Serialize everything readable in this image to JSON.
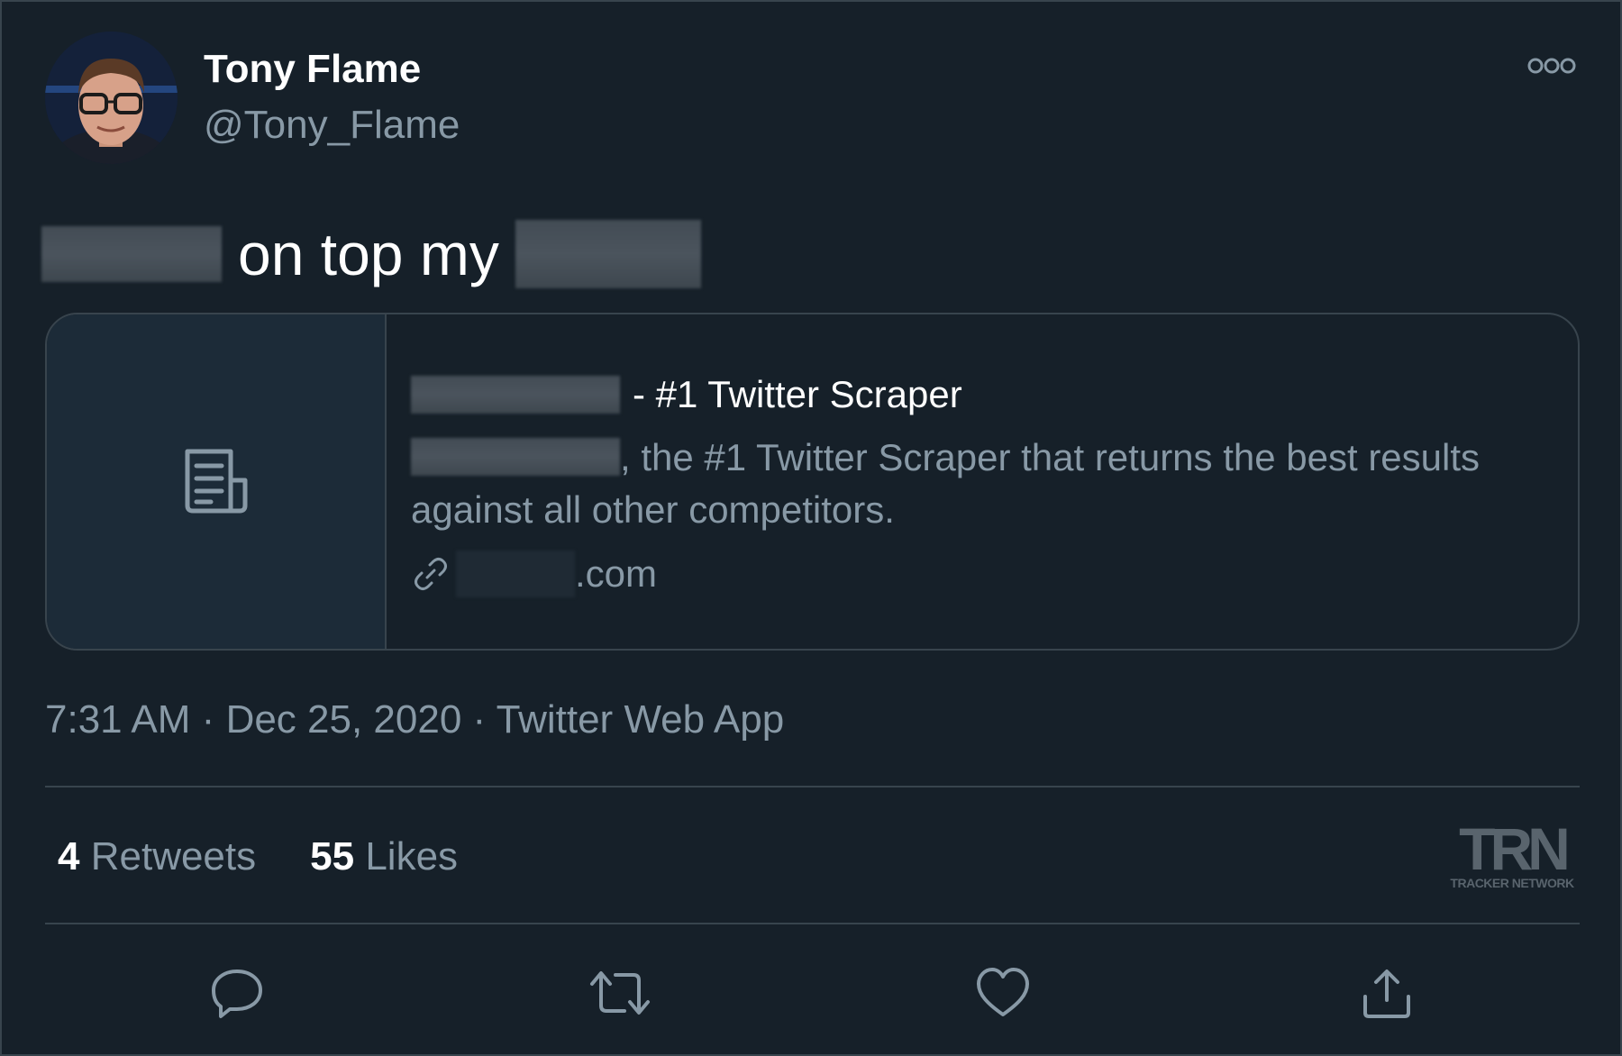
{
  "author": {
    "name": "Tony Flame",
    "handle": "@Tony_Flame"
  },
  "tweet": {
    "text_middle": "on top my"
  },
  "card": {
    "title_suffix": "- #1 Twitter Scraper",
    "description_suffix": ", the #1 Twitter Scraper that returns the best results against all other competitors.",
    "link_suffix": ".com",
    "thumbnail_icon": "document-icon",
    "link_icon": "link-icon"
  },
  "meta": {
    "time": "7:31 AM",
    "separator": "·",
    "date": "Dec 25, 2020",
    "source": "Twitter Web App"
  },
  "stats": {
    "retweets_count": "4",
    "retweets_label": "Retweets",
    "likes_count": "55",
    "likes_label": "Likes"
  },
  "watermark": {
    "logo": "TRN",
    "subtitle": "TRACKER NETWORK"
  },
  "actions": {
    "reply_icon": "reply-icon",
    "retweet_icon": "retweet-icon",
    "like_icon": "heart-icon",
    "share_icon": "share-icon",
    "more_icon": "more-icon"
  },
  "colors": {
    "background": "#162029",
    "border": "#38444d",
    "secondary_text": "#8899a6",
    "primary_text": "#ffffff"
  }
}
